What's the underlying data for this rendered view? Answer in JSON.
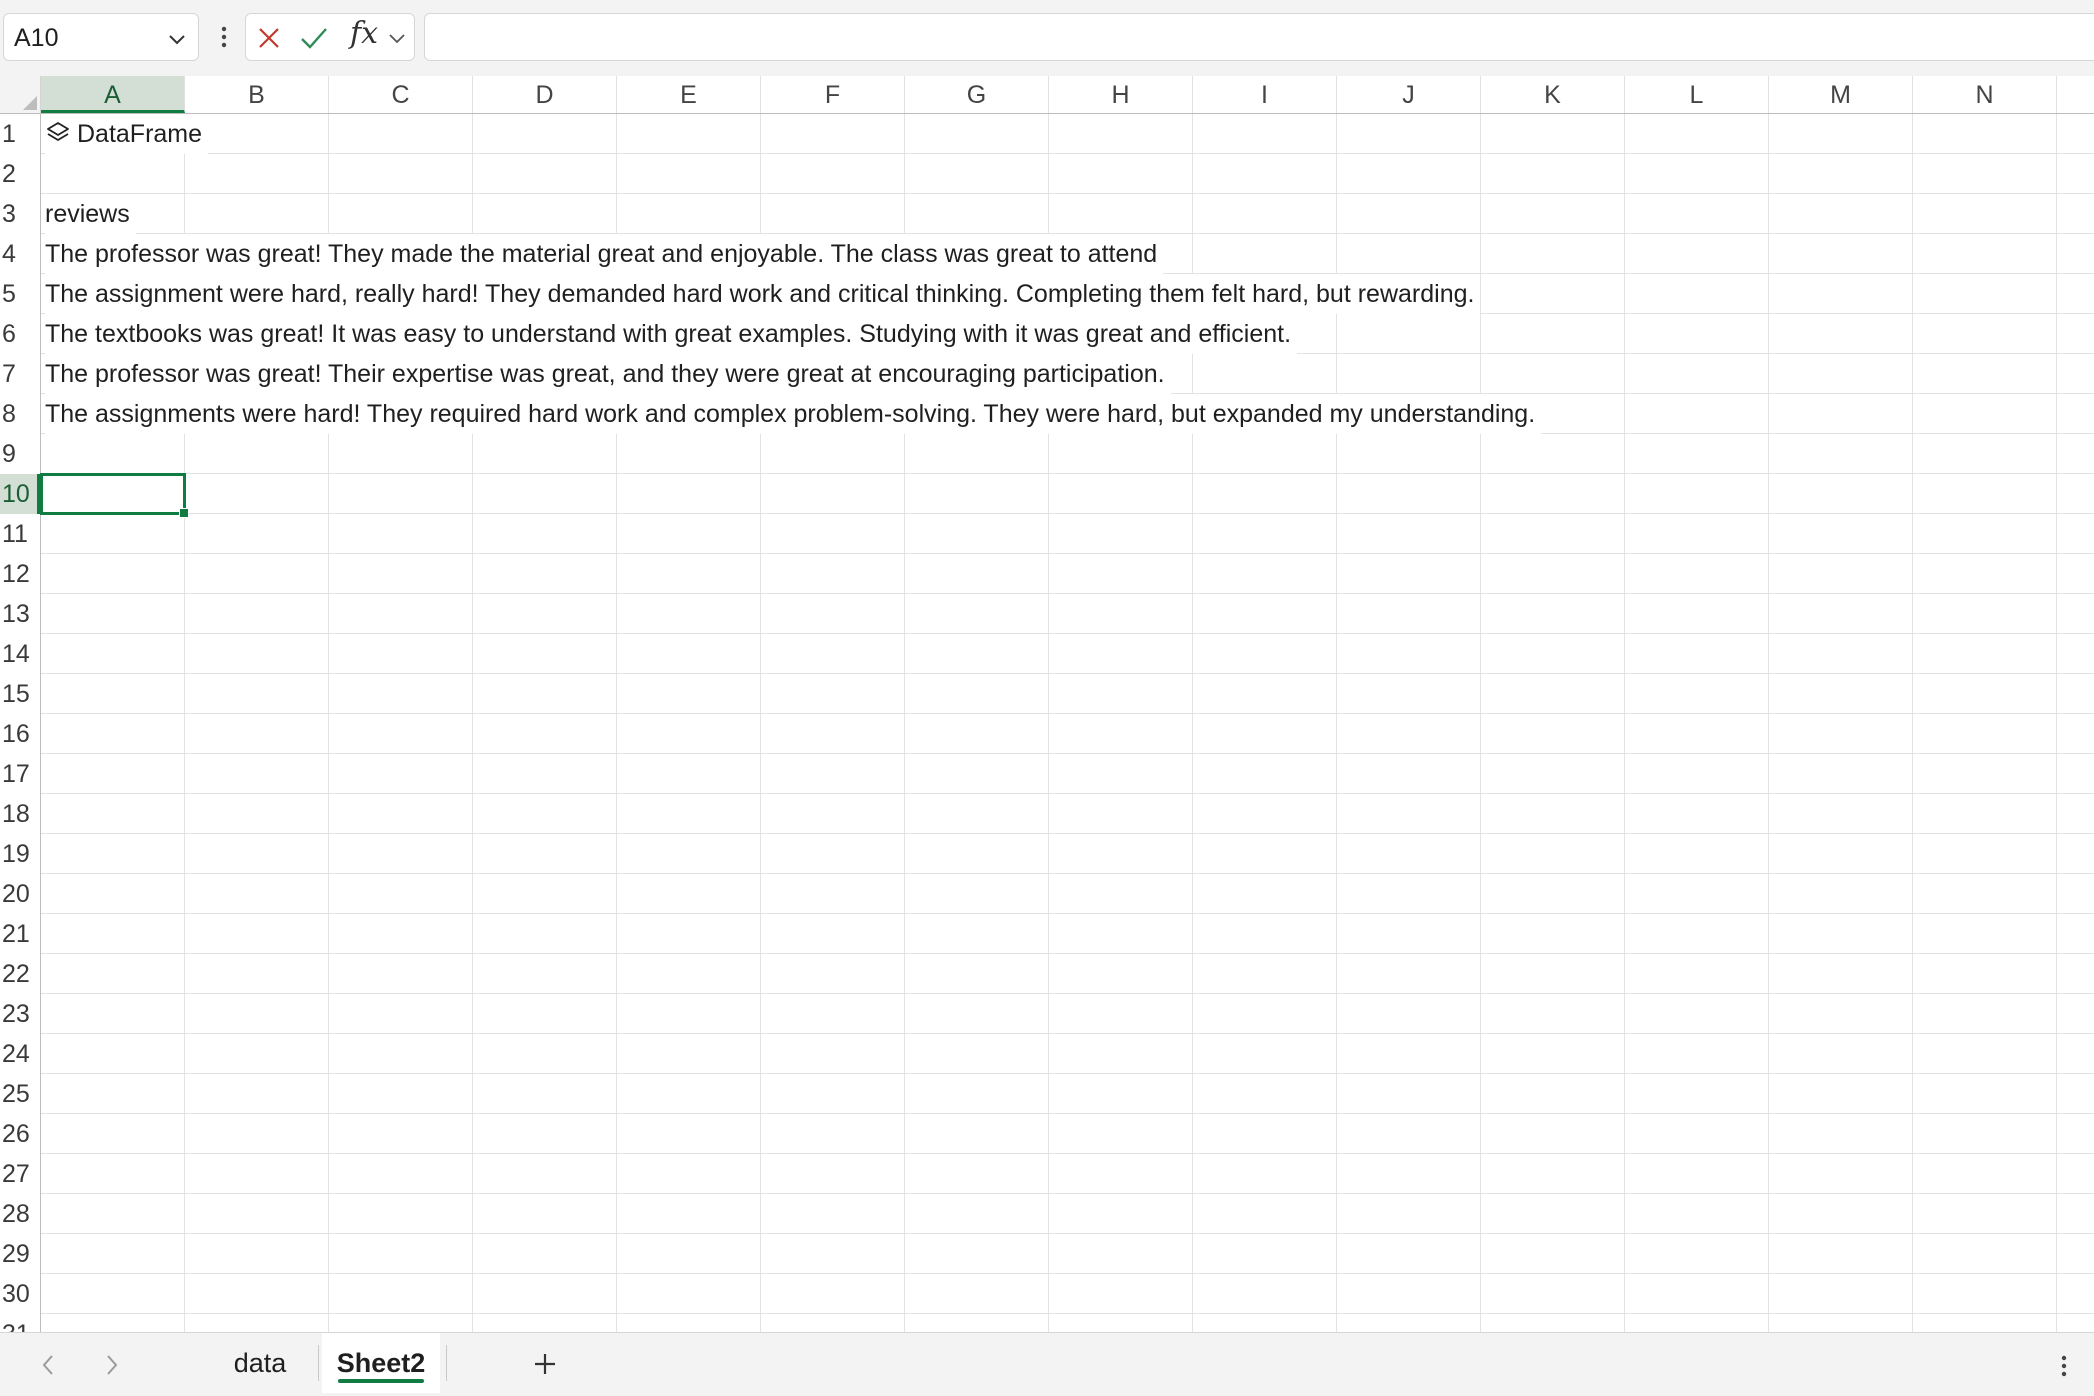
{
  "formula_bar": {
    "name_box": "A10",
    "fx_label": "fx",
    "formula": ""
  },
  "columns": [
    "A",
    "B",
    "C",
    "D",
    "E",
    "F",
    "G",
    "H",
    "I",
    "J",
    "K",
    "L",
    "M",
    "N"
  ],
  "rows": [
    "1",
    "2",
    "3",
    "4",
    "5",
    "6",
    "7",
    "8",
    "9",
    "10",
    "11",
    "12",
    "13",
    "14",
    "15",
    "16",
    "17",
    "18",
    "19",
    "20",
    "21",
    "22",
    "23",
    "24",
    "25",
    "26",
    "27",
    "28",
    "29",
    "30",
    "31"
  ],
  "selected": {
    "cell": "A10",
    "column": "A",
    "row": "10"
  },
  "cells": {
    "A1": "DataFrame",
    "A3": "reviews",
    "A4": "The professor was great! They made the material great and enjoyable. The class was great to attend",
    "A5": "The assignment were hard, really hard! They demanded hard work and critical thinking. Completing them felt hard, but rewarding.",
    "A6": "The textbooks was great! It was easy to understand with great examples. Studying with it was great and efficient.",
    "A7": "The professor was great! Their expertise was great, and they were great at encouraging participation.",
    "A8": "The assignments were hard! They required hard work and complex problem-solving. They were hard, but expanded my understanding."
  },
  "sheet_tabs": {
    "tabs": [
      "data",
      "Sheet2"
    ],
    "active": "Sheet2"
  },
  "colors": {
    "accent": "#107c41",
    "selection_header": "#d3dfd5",
    "gridline": "#e3e3e3"
  },
  "icons": {
    "name_box_dropdown": "chevron-down-icon",
    "cancel": "close-icon",
    "enter": "check-icon",
    "insert_function": "fx-icon",
    "dataframe": "layers-icon",
    "add_sheet": "plus-icon"
  }
}
